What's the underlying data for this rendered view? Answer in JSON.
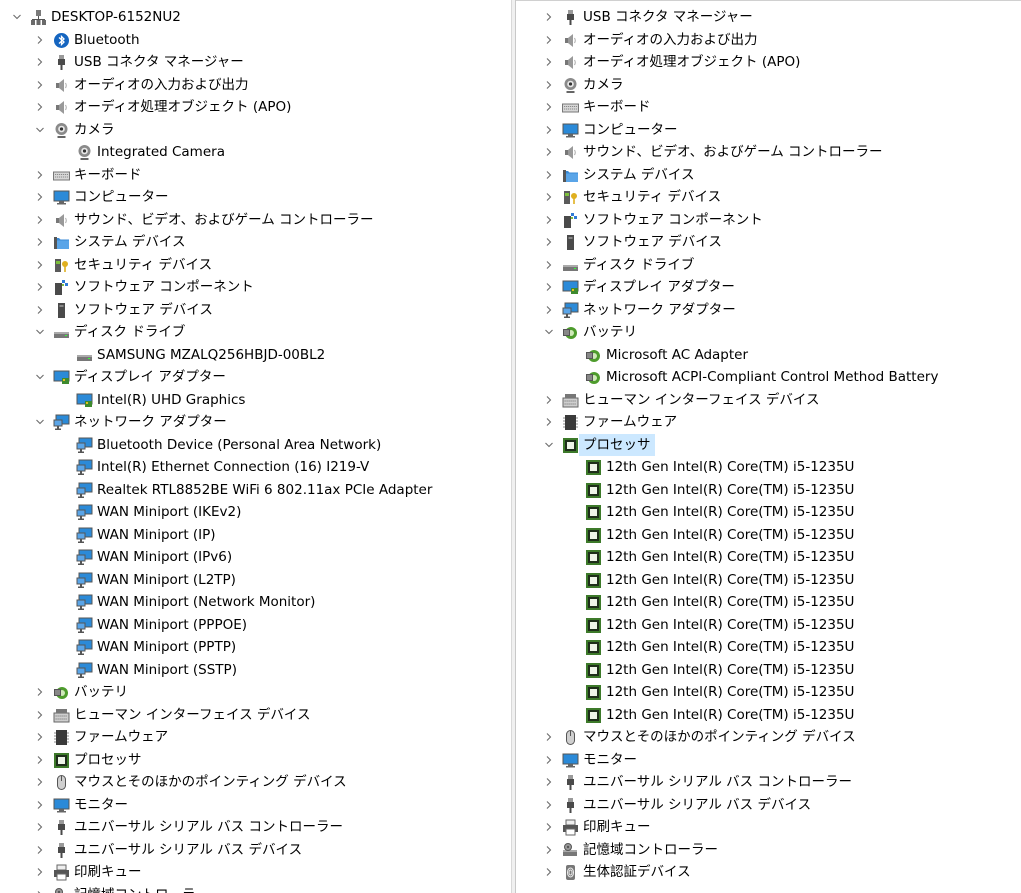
{
  "left_tree": [
    {
      "depth": 0,
      "label": "DESKTOP-6152NU2",
      "icon": "computer-network-icon",
      "expanded": true
    },
    {
      "depth": 1,
      "label": "Bluetooth",
      "icon": "bluetooth-icon",
      "expanded": false
    },
    {
      "depth": 1,
      "label": "USB コネクタ マネージャー",
      "icon": "usb-plug-icon",
      "expanded": false
    },
    {
      "depth": 1,
      "label": "オーディオの入力および出力",
      "icon": "speaker-icon",
      "expanded": false
    },
    {
      "depth": 1,
      "label": "オーディオ処理オブジェクト (APO)",
      "icon": "speaker-icon",
      "expanded": false
    },
    {
      "depth": 1,
      "label": "カメラ",
      "icon": "webcam-icon",
      "expanded": true
    },
    {
      "depth": 2,
      "label": "Integrated Camera",
      "icon": "webcam-icon"
    },
    {
      "depth": 1,
      "label": "キーボード",
      "icon": "keyboard-icon",
      "expanded": false
    },
    {
      "depth": 1,
      "label": "コンピューター",
      "icon": "monitor-icon",
      "expanded": false
    },
    {
      "depth": 1,
      "label": "サウンド、ビデオ、およびゲーム コントローラー",
      "icon": "speaker-icon",
      "expanded": false
    },
    {
      "depth": 1,
      "label": "システム デバイス",
      "icon": "system-folder-icon",
      "expanded": false
    },
    {
      "depth": 1,
      "label": "セキュリティ デバイス",
      "icon": "security-key-icon",
      "expanded": false
    },
    {
      "depth": 1,
      "label": "ソフトウェア コンポーネント",
      "icon": "software-component-icon",
      "expanded": false
    },
    {
      "depth": 1,
      "label": "ソフトウェア デバイス",
      "icon": "software-device-icon",
      "expanded": false
    },
    {
      "depth": 1,
      "label": "ディスク ドライブ",
      "icon": "disk-drive-icon",
      "expanded": true
    },
    {
      "depth": 2,
      "label": "SAMSUNG MZALQ256HBJD-00BL2",
      "icon": "disk-drive-icon"
    },
    {
      "depth": 1,
      "label": "ディスプレイ アダプター",
      "icon": "display-adapter-icon",
      "expanded": true
    },
    {
      "depth": 2,
      "label": "Intel(R) UHD Graphics",
      "icon": "display-adapter-icon"
    },
    {
      "depth": 1,
      "label": "ネットワーク アダプター",
      "icon": "network-adapter-icon",
      "expanded": true
    },
    {
      "depth": 2,
      "label": "Bluetooth Device (Personal Area Network)",
      "icon": "network-adapter-icon"
    },
    {
      "depth": 2,
      "label": "Intel(R) Ethernet Connection (16) I219-V",
      "icon": "network-adapter-icon"
    },
    {
      "depth": 2,
      "label": "Realtek RTL8852BE WiFi 6 802.11ax PCIe Adapter",
      "icon": "network-adapter-icon"
    },
    {
      "depth": 2,
      "label": "WAN Miniport (IKEv2)",
      "icon": "network-adapter-icon"
    },
    {
      "depth": 2,
      "label": "WAN Miniport (IP)",
      "icon": "network-adapter-icon"
    },
    {
      "depth": 2,
      "label": "WAN Miniport (IPv6)",
      "icon": "network-adapter-icon"
    },
    {
      "depth": 2,
      "label": "WAN Miniport (L2TP)",
      "icon": "network-adapter-icon"
    },
    {
      "depth": 2,
      "label": "WAN Miniport (Network Monitor)",
      "icon": "network-adapter-icon"
    },
    {
      "depth": 2,
      "label": "WAN Miniport (PPPOE)",
      "icon": "network-adapter-icon"
    },
    {
      "depth": 2,
      "label": "WAN Miniport (PPTP)",
      "icon": "network-adapter-icon"
    },
    {
      "depth": 2,
      "label": "WAN Miniport (SSTP)",
      "icon": "network-adapter-icon"
    },
    {
      "depth": 1,
      "label": "バッテリ",
      "icon": "battery-icon",
      "expanded": false
    },
    {
      "depth": 1,
      "label": "ヒューマン インターフェイス デバイス",
      "icon": "hid-icon",
      "expanded": false
    },
    {
      "depth": 1,
      "label": "ファームウェア",
      "icon": "firmware-icon",
      "expanded": false
    },
    {
      "depth": 1,
      "label": "プロセッサ",
      "icon": "processor-icon",
      "expanded": false
    },
    {
      "depth": 1,
      "label": "マウスとそのほかのポインティング デバイス",
      "icon": "mouse-icon",
      "expanded": false
    },
    {
      "depth": 1,
      "label": "モニター",
      "icon": "monitor-icon",
      "expanded": false
    },
    {
      "depth": 1,
      "label": "ユニバーサル シリアル バス コントローラー",
      "icon": "usb-plug-icon",
      "expanded": false
    },
    {
      "depth": 1,
      "label": "ユニバーサル シリアル バス デバイス",
      "icon": "usb-plug-icon",
      "expanded": false
    },
    {
      "depth": 1,
      "label": "印刷キュー",
      "icon": "printer-icon",
      "expanded": false
    },
    {
      "depth": 1,
      "label": "記憶域コントローラー",
      "icon": "storage-controller-icon",
      "expanded": false
    }
  ],
  "right_tree": [
    {
      "depth": 1,
      "label": "USB コネクタ マネージャー",
      "icon": "usb-plug-icon",
      "expanded": false
    },
    {
      "depth": 1,
      "label": "オーディオの入力および出力",
      "icon": "speaker-icon",
      "expanded": false
    },
    {
      "depth": 1,
      "label": "オーディオ処理オブジェクト (APO)",
      "icon": "speaker-icon",
      "expanded": false
    },
    {
      "depth": 1,
      "label": "カメラ",
      "icon": "webcam-icon",
      "expanded": false
    },
    {
      "depth": 1,
      "label": "キーボード",
      "icon": "keyboard-icon",
      "expanded": false
    },
    {
      "depth": 1,
      "label": "コンピューター",
      "icon": "monitor-icon",
      "expanded": false
    },
    {
      "depth": 1,
      "label": "サウンド、ビデオ、およびゲーム コントローラー",
      "icon": "speaker-icon",
      "expanded": false
    },
    {
      "depth": 1,
      "label": "システム デバイス",
      "icon": "system-folder-icon",
      "expanded": false
    },
    {
      "depth": 1,
      "label": "セキュリティ デバイス",
      "icon": "security-key-icon",
      "expanded": false
    },
    {
      "depth": 1,
      "label": "ソフトウェア コンポーネント",
      "icon": "software-component-icon",
      "expanded": false
    },
    {
      "depth": 1,
      "label": "ソフトウェア デバイス",
      "icon": "software-device-icon",
      "expanded": false
    },
    {
      "depth": 1,
      "label": "ディスク ドライブ",
      "icon": "disk-drive-icon",
      "expanded": false
    },
    {
      "depth": 1,
      "label": "ディスプレイ アダプター",
      "icon": "display-adapter-icon",
      "expanded": false
    },
    {
      "depth": 1,
      "label": "ネットワーク アダプター",
      "icon": "network-adapter-icon",
      "expanded": false
    },
    {
      "depth": 1,
      "label": "バッテリ",
      "icon": "battery-icon",
      "expanded": true
    },
    {
      "depth": 2,
      "label": "Microsoft AC Adapter",
      "icon": "battery-icon"
    },
    {
      "depth": 2,
      "label": "Microsoft ACPI-Compliant Control Method Battery",
      "icon": "battery-icon"
    },
    {
      "depth": 1,
      "label": "ヒューマン インターフェイス デバイス",
      "icon": "hid-icon",
      "expanded": false
    },
    {
      "depth": 1,
      "label": "ファームウェア",
      "icon": "firmware-icon",
      "expanded": false
    },
    {
      "depth": 1,
      "label": "プロセッサ",
      "icon": "processor-icon",
      "expanded": true,
      "selected": true
    },
    {
      "depth": 2,
      "label": "12th Gen Intel(R) Core(TM) i5-1235U",
      "icon": "processor-icon"
    },
    {
      "depth": 2,
      "label": "12th Gen Intel(R) Core(TM) i5-1235U",
      "icon": "processor-icon"
    },
    {
      "depth": 2,
      "label": "12th Gen Intel(R) Core(TM) i5-1235U",
      "icon": "processor-icon"
    },
    {
      "depth": 2,
      "label": "12th Gen Intel(R) Core(TM) i5-1235U",
      "icon": "processor-icon"
    },
    {
      "depth": 2,
      "label": "12th Gen Intel(R) Core(TM) i5-1235U",
      "icon": "processor-icon"
    },
    {
      "depth": 2,
      "label": "12th Gen Intel(R) Core(TM) i5-1235U",
      "icon": "processor-icon"
    },
    {
      "depth": 2,
      "label": "12th Gen Intel(R) Core(TM) i5-1235U",
      "icon": "processor-icon"
    },
    {
      "depth": 2,
      "label": "12th Gen Intel(R) Core(TM) i5-1235U",
      "icon": "processor-icon"
    },
    {
      "depth": 2,
      "label": "12th Gen Intel(R) Core(TM) i5-1235U",
      "icon": "processor-icon"
    },
    {
      "depth": 2,
      "label": "12th Gen Intel(R) Core(TM) i5-1235U",
      "icon": "processor-icon"
    },
    {
      "depth": 2,
      "label": "12th Gen Intel(R) Core(TM) i5-1235U",
      "icon": "processor-icon"
    },
    {
      "depth": 2,
      "label": "12th Gen Intel(R) Core(TM) i5-1235U",
      "icon": "processor-icon"
    },
    {
      "depth": 1,
      "label": "マウスとそのほかのポインティング デバイス",
      "icon": "mouse-icon",
      "expanded": false
    },
    {
      "depth": 1,
      "label": "モニター",
      "icon": "monitor-icon",
      "expanded": false
    },
    {
      "depth": 1,
      "label": "ユニバーサル シリアル バス コントローラー",
      "icon": "usb-plug-icon",
      "expanded": false
    },
    {
      "depth": 1,
      "label": "ユニバーサル シリアル バス デバイス",
      "icon": "usb-plug-icon",
      "expanded": false
    },
    {
      "depth": 1,
      "label": "印刷キュー",
      "icon": "printer-icon",
      "expanded": false
    },
    {
      "depth": 1,
      "label": "記憶域コントローラー",
      "icon": "storage-controller-icon",
      "expanded": false
    },
    {
      "depth": 1,
      "label": "生体認証デバイス",
      "icon": "biometric-icon",
      "expanded": false
    }
  ],
  "colors": {
    "selection": "#cce8ff",
    "text": "#000000",
    "expander": "#6b6b6b",
    "background": "#ffffff"
  }
}
